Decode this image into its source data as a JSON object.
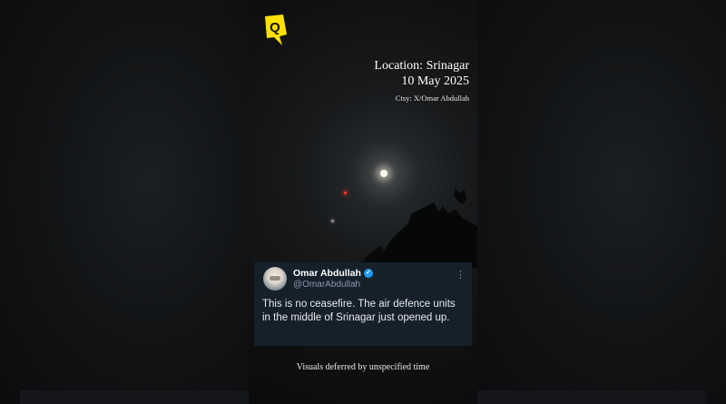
{
  "overlay": {
    "location_line": "Location: Srinagar",
    "date_line": "10 May 2025",
    "credit": "Ctsy: X/Omar Abdullah",
    "caption": "Visuals deferred by unspecified time"
  },
  "brand": {
    "logo_letter": "Q",
    "accent_color": "#ffe100"
  },
  "tweet": {
    "display_name": "Omar Abdullah",
    "handle": "@OmarAbdullah",
    "verified_mark": "✓",
    "more_glyph": "⋮",
    "text": "This is no ceasefire. The air defence units in the middle of Srinagar just opened up.",
    "background_color": "#15202b",
    "verified_color": "#1d9bf0"
  }
}
